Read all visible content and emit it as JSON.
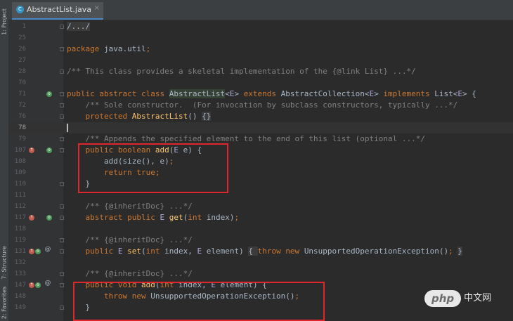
{
  "sidebar": {
    "tabs": [
      {
        "label": "1: Project"
      },
      {
        "label": "7: Structure"
      },
      {
        "label": "2: Favorites"
      }
    ]
  },
  "editor_tab": {
    "icon": "java-class-icon",
    "filename": "AbstractList.java",
    "close": "×"
  },
  "lines": [
    {
      "num": "1",
      "code": [
        {
          "t": "/.../",
          "c": "bx"
        }
      ]
    },
    {
      "num": "25",
      "code": []
    },
    {
      "num": "26",
      "code": [
        {
          "t": "package ",
          "c": "kw"
        },
        {
          "t": "java.util"
        },
        {
          "t": ";",
          "c": "kw"
        }
      ]
    },
    {
      "num": "27",
      "code": []
    },
    {
      "num": "28",
      "code": [
        {
          "t": "/** This class provides a skeletal implementation of the {@link List} ...*/",
          "c": "cm"
        }
      ]
    },
    {
      "num": "70",
      "code": []
    },
    {
      "num": "71",
      "code": [
        {
          "t": "public abstract class ",
          "c": "kw"
        },
        {
          "t": "AbstractList",
          "c": "hl"
        },
        {
          "t": "<"
        },
        {
          "t": "E",
          "c": "tp"
        },
        {
          "t": "> "
        },
        {
          "t": "extends ",
          "c": "kw"
        },
        {
          "t": "AbstractCollection<"
        },
        {
          "t": "E",
          "c": "tp"
        },
        {
          "t": "> "
        },
        {
          "t": "implements ",
          "c": "kw"
        },
        {
          "t": "List<"
        },
        {
          "t": "E",
          "c": "tp"
        },
        {
          "t": "> {"
        }
      ]
    },
    {
      "num": "72",
      "code": [
        {
          "t": "    "
        },
        {
          "t": "/** Sole constructor.  (For invocation by subclass constructors, typically ...*/",
          "c": "cm"
        }
      ]
    },
    {
      "num": "76",
      "code": [
        {
          "t": "    "
        },
        {
          "t": "protected ",
          "c": "kw"
        },
        {
          "t": "AbstractList",
          "c": "fn"
        },
        {
          "t": "() "
        },
        {
          "t": "{}",
          "c": "bx"
        }
      ]
    },
    {
      "num": "78",
      "code": []
    },
    {
      "num": "79",
      "code": [
        {
          "t": "    "
        },
        {
          "t": "/** Appends the specified element to the end of this list (optional ...*/",
          "c": "cm"
        }
      ]
    },
    {
      "num": "107",
      "code": [
        {
          "t": "    "
        },
        {
          "t": "public boolean ",
          "c": "kw"
        },
        {
          "t": "add",
          "c": "fn"
        },
        {
          "t": "("
        },
        {
          "t": "E",
          "c": "tp"
        },
        {
          "t": " e) {"
        }
      ]
    },
    {
      "num": "108",
      "code": [
        {
          "t": "        add(size(), e)"
        },
        {
          "t": ";",
          "c": "kw"
        }
      ]
    },
    {
      "num": "109",
      "code": [
        {
          "t": "        "
        },
        {
          "t": "return true;",
          "c": "kw"
        }
      ]
    },
    {
      "num": "110",
      "code": [
        {
          "t": "    }"
        }
      ]
    },
    {
      "num": "111",
      "code": []
    },
    {
      "num": "112",
      "code": [
        {
          "t": "    "
        },
        {
          "t": "/** {@inheritDoc} ...*/",
          "c": "cm"
        }
      ]
    },
    {
      "num": "117",
      "code": [
        {
          "t": "    "
        },
        {
          "t": "abstract public ",
          "c": "kw"
        },
        {
          "t": "E ",
          "c": "tp"
        },
        {
          "t": "get",
          "c": "fn"
        },
        {
          "t": "("
        },
        {
          "t": "int ",
          "c": "kw"
        },
        {
          "t": "index)"
        },
        {
          "t": ";",
          "c": "kw"
        }
      ]
    },
    {
      "num": "118",
      "code": []
    },
    {
      "num": "119",
      "code": [
        {
          "t": "    "
        },
        {
          "t": "/** {@inheritDoc} ...*/",
          "c": "cm"
        }
      ]
    },
    {
      "num": "131",
      "code": [
        {
          "t": "    "
        },
        {
          "t": "public ",
          "c": "kw"
        },
        {
          "t": "E ",
          "c": "tp"
        },
        {
          "t": "set",
          "c": "fn"
        },
        {
          "t": "("
        },
        {
          "t": "int ",
          "c": "kw"
        },
        {
          "t": "index, "
        },
        {
          "t": "E ",
          "c": "tp"
        },
        {
          "t": "element) "
        },
        {
          "t": "{ ",
          "c": "bx"
        },
        {
          "t": "throw new ",
          "c": "kw"
        },
        {
          "t": "UnsupportedOperationException()"
        },
        {
          "t": "; ",
          "c": "kw"
        },
        {
          "t": "}",
          "c": "bx"
        }
      ]
    },
    {
      "num": "132",
      "code": []
    },
    {
      "num": "133",
      "code": [
        {
          "t": "    "
        },
        {
          "t": "/** {@inheritDoc} ...*/",
          "c": "cm"
        }
      ]
    },
    {
      "num": "147",
      "code": [
        {
          "t": "    "
        },
        {
          "t": "public void ",
          "c": "kw"
        },
        {
          "t": "add",
          "c": "fn"
        },
        {
          "t": "("
        },
        {
          "t": "int ",
          "c": "kw"
        },
        {
          "t": "index, "
        },
        {
          "t": "E ",
          "c": "tp"
        },
        {
          "t": "element) {"
        }
      ]
    },
    {
      "num": "148",
      "code": [
        {
          "t": "        "
        },
        {
          "t": "throw new ",
          "c": "kw"
        },
        {
          "t": "UnsupportedOperationException()"
        },
        {
          "t": ";",
          "c": "kw"
        }
      ]
    },
    {
      "num": "149",
      "code": [
        {
          "t": "    }"
        }
      ]
    }
  ],
  "gutter_marks": {
    "71": [
      "implemented-icon"
    ],
    "107": [
      "override-icon",
      "implemented-icon"
    ],
    "117": [
      "override-icon",
      "implemented-icon"
    ],
    "131": [
      "override-icon",
      "implemented-icon-o",
      "annotation-icon"
    ],
    "147": [
      "override-icon",
      "implemented-icon-o",
      "annotation-icon"
    ]
  },
  "annotation_glyph": "@",
  "current_line": "78",
  "highlight_color": "#e0262d",
  "watermark": {
    "badge": "php",
    "text": "中文网"
  }
}
